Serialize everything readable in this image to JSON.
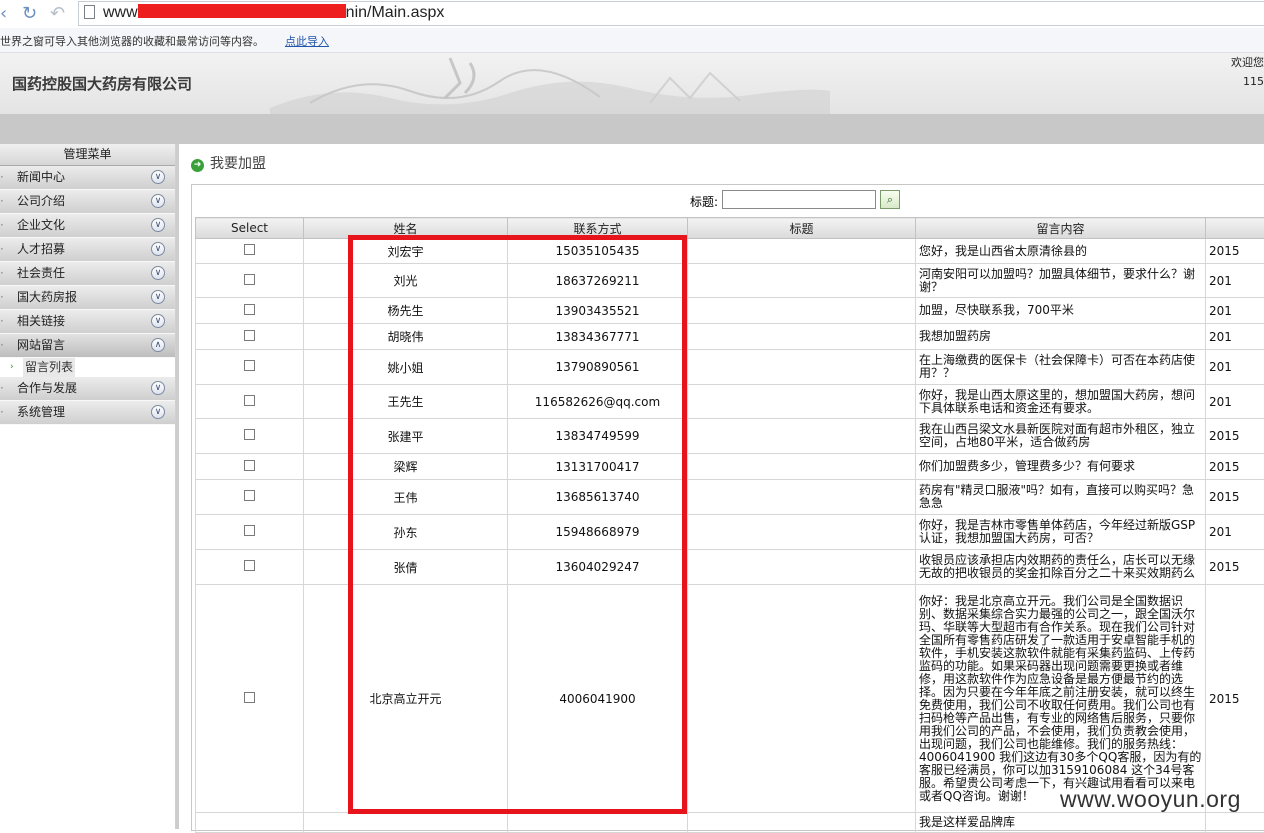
{
  "browser": {
    "url_prefix": "www",
    "url_suffix": "nin/Main.aspx",
    "favbar_text": "世界之窗可导入其他浏览器的收藏和最常访问等内容。",
    "favbar_link": "点此导入"
  },
  "header": {
    "company": "国药控股国大药房有限公司",
    "welcome": "欢迎您",
    "number": "115"
  },
  "sidebar": {
    "title": "管理菜单",
    "items": [
      {
        "label": "新闻中心"
      },
      {
        "label": "公司介绍"
      },
      {
        "label": "企业文化"
      },
      {
        "label": "人才招募"
      },
      {
        "label": "社会责任"
      },
      {
        "label": "国大药房报"
      },
      {
        "label": "相关链接"
      },
      {
        "label": "网站留言"
      },
      {
        "label": "合作与发展"
      },
      {
        "label": "系统管理"
      }
    ],
    "submenu_label": "留言列表"
  },
  "main": {
    "breadcrumb": "我要加盟",
    "search_label": "标题:",
    "search_value": "",
    "columns": [
      "Select",
      "姓名",
      "联系方式",
      "标题",
      "留言内容",
      ""
    ],
    "rows": [
      {
        "name": "刘宏宇",
        "contact": "15035105435",
        "title": "",
        "message": "您好，我是山西省太原清徐县的",
        "date": "2015"
      },
      {
        "name": "刘光",
        "contact": "18637269211",
        "title": "",
        "message": "河南安阳可以加盟吗？加盟具体细节，要求什么？谢谢？",
        "date": "201"
      },
      {
        "name": "杨先生",
        "contact": "13903435521",
        "title": "",
        "message": "加盟，尽快联系我，700平米",
        "date": "201"
      },
      {
        "name": "胡晓伟",
        "contact": "13834367771",
        "title": "",
        "message": "我想加盟药房",
        "date": "201"
      },
      {
        "name": "姚小姐",
        "contact": "13790890561",
        "title": "",
        "message": "在上海缴费的医保卡（社会保障卡）可否在本药店使用？？",
        "date": "201"
      },
      {
        "name": "王先生",
        "contact": "116582626@qq.com",
        "title": "",
        "message": "你好，我是山西太原这里的，想加盟国大药房，想问下具体联系电话和资金还有要求。",
        "date": "201"
      },
      {
        "name": "张建平",
        "contact": "13834749599",
        "title": "",
        "message": "我在山西吕梁文水县新医院对面有超市外租区，独立空间，占地80平米，适合做药房",
        "date": "2015"
      },
      {
        "name": "梁辉",
        "contact": "13131700417",
        "title": "",
        "message": "你们加盟费多少，管理费多少？有何要求",
        "date": "2015"
      },
      {
        "name": "王伟",
        "contact": "13685613740",
        "title": "",
        "message": "药房有\"精灵口服液\"吗？如有，直接可以购买吗？急急急",
        "date": "2015"
      },
      {
        "name": "孙东",
        "contact": "15948668979",
        "title": "",
        "message": "你好，我是吉林市零售单体药店，今年经过新版GSP认证，我想加盟国大药房，可否？",
        "date": "201"
      },
      {
        "name": "张倩",
        "contact": "13604029247",
        "title": "",
        "message": "收银员应该承担店内效期药的责任么，店长可以无缘无故的把收银员的奖金扣除百分之二十来买效期药么",
        "date": "2015"
      },
      {
        "name": "北京高立开元",
        "contact": "4006041900",
        "title": "",
        "message": "你好：我是北京高立开元。我们公司是全国数据识别、数据采集综合实力最强的公司之一，跟全国沃尔玛、华联等大型超市有合作关系。现在我们公司针对全国所有零售药店研发了一款适用于安卓智能手机的软件，手机安装这款软件就能有采集药监码、上传药监码的功能。如果采码器出现问题需要更换或者维修，用这款软件作为应急设备是最方便最节约的选择。因为只要在今年年底之前注册安装，就可以终生免费使用，我们公司不收取任何费用。我们公司也有扫码枪等产品出售，有专业的网络售后服务，只要你用我们公司的产品，不会使用，我们负责教会使用，出现问题，我们公司也能维修。我们的服务热线：4006041900 我们这边有30多个QQ客服，因为有的客服已经满员，你可以加3159106084 这个34号客服。希望贵公司考虑一下，有兴趣试用看看可以来电或者QQ咨询。谢谢！",
        "date": "2015"
      },
      {
        "name": "",
        "contact": "",
        "title": "",
        "message": "我是这样爱品牌库",
        "date": ""
      }
    ]
  },
  "watermark": "www.wooyun.org",
  "colors": {
    "highlight": "#e8141c",
    "accent_green": "#3aa03a"
  }
}
